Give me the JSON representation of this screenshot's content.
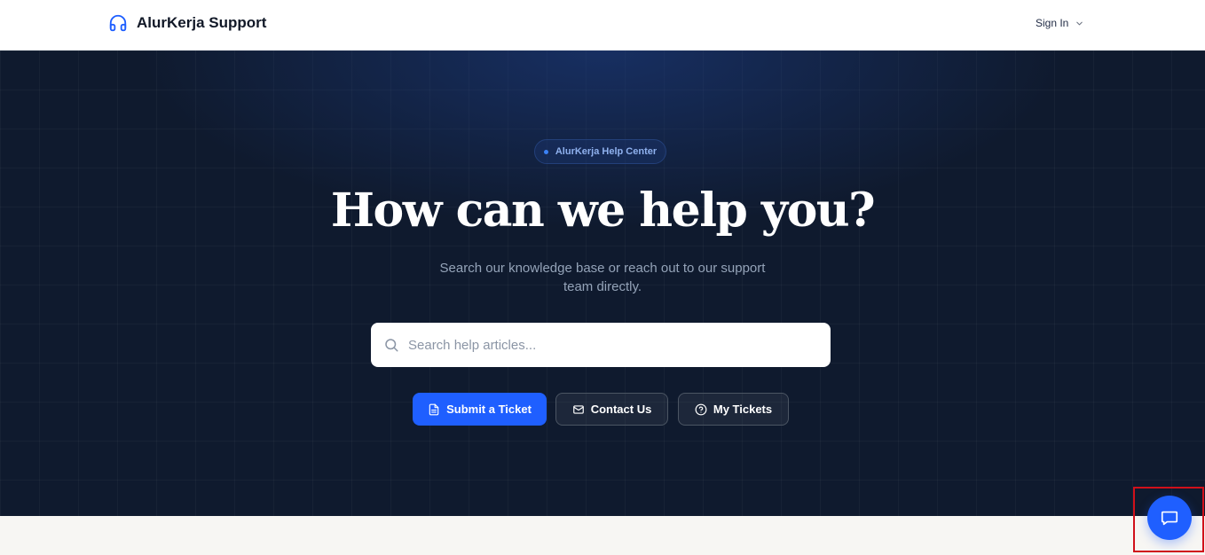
{
  "header": {
    "brand_name": "AlurKerja Support",
    "brand_icon": "headphones-icon",
    "signin_label": "Sign In"
  },
  "hero": {
    "badge_label": "AlurKerja Help Center",
    "title": "How can we help you?",
    "subtitle": "Search our knowledge base or reach out to our support team directly.",
    "search": {
      "placeholder": "Search help articles...",
      "value": ""
    },
    "actions": {
      "submit_ticket": "Submit a Ticket",
      "contact_us": "Contact Us",
      "my_tickets": "My Tickets"
    }
  },
  "chat": {
    "icon": "chat-bubble-icon"
  },
  "colors": {
    "accent": "#1f5fff",
    "hero_bg": "#0f1a2e",
    "badge_text": "#8fb1ee",
    "highlight": "#d0101a"
  }
}
